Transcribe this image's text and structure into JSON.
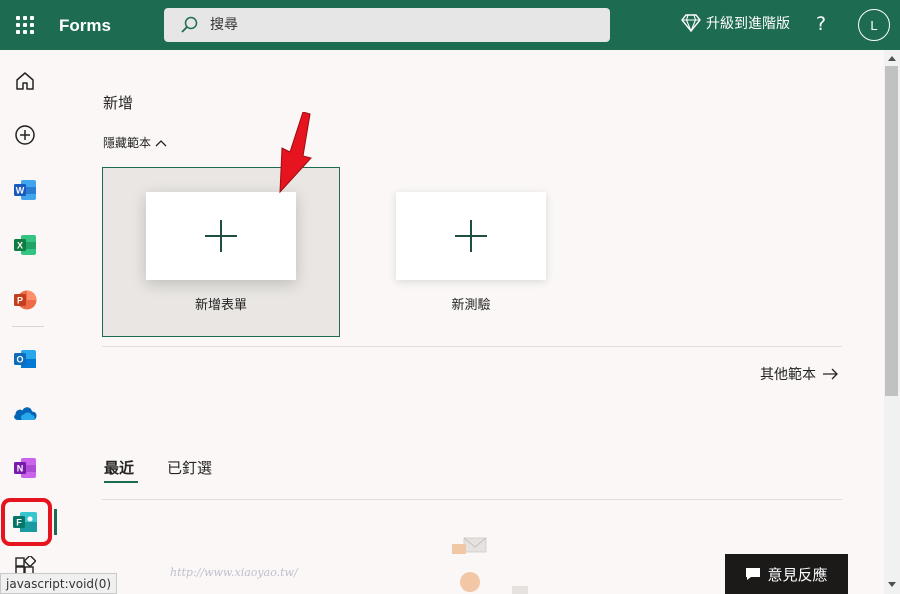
{
  "app": {
    "name": "Forms"
  },
  "search": {
    "placeholder": "搜尋"
  },
  "header": {
    "upgrade_label": "升級到進階版",
    "help_label": "?",
    "avatar_initial": "L"
  },
  "rail": {
    "items": [
      {
        "name": "home-icon"
      },
      {
        "name": "create-icon"
      },
      {
        "name": "word-icon",
        "color": "#185abd"
      },
      {
        "name": "excel-icon",
        "color": "#107c41"
      },
      {
        "name": "powerpoint-icon",
        "color": "#c43e1c"
      },
      {
        "name": "outlook-icon",
        "color": "#0f6cbd"
      },
      {
        "name": "onedrive-icon",
        "color": "#0364b8"
      },
      {
        "name": "onenote-icon",
        "color": "#7719aa"
      },
      {
        "name": "forms-icon",
        "color": "#077568"
      },
      {
        "name": "apps-icon"
      }
    ]
  },
  "main": {
    "new_title": "新增",
    "hide_templates": "隱藏範本",
    "tiles": [
      {
        "label": "新增表單"
      },
      {
        "label": "新測驗"
      }
    ],
    "more_templates": "其他範本",
    "tabs": [
      {
        "label": "最近",
        "active": true
      },
      {
        "label": "已釘選",
        "active": false
      }
    ]
  },
  "feedback": {
    "label": "意見反應"
  },
  "status_bar": {
    "text": "javascript:void(0)"
  },
  "watermark": {
    "text": "http://www.xiaoyao.tw/"
  },
  "colors": {
    "brand": "#1d6b51",
    "highlight": "#e5141f"
  }
}
